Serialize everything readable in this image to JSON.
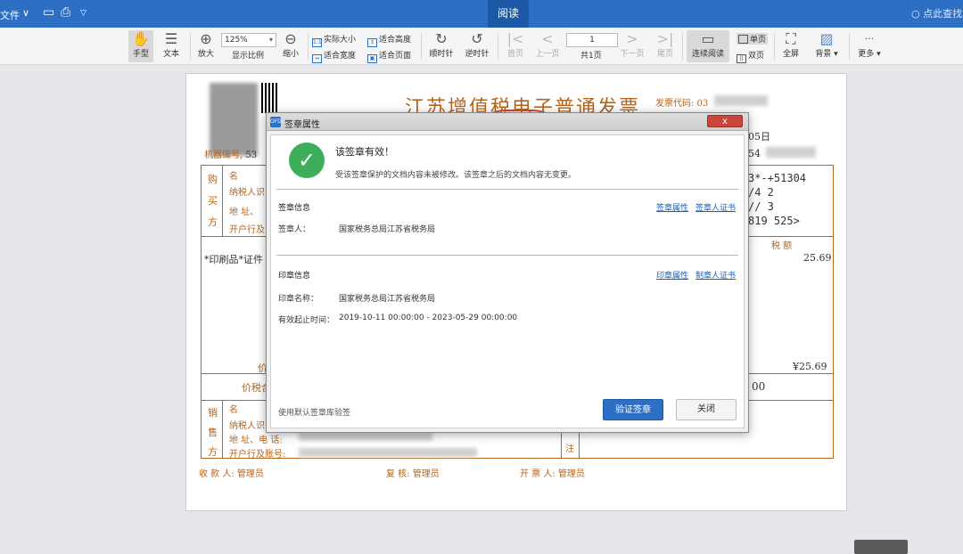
{
  "menubar": {
    "file_label": "文件",
    "active_tab": "阅读",
    "search_placeholder": "点此查找文"
  },
  "toolbar": {
    "hand": "手型",
    "text": "文本",
    "zoom_in": "放大",
    "zoom_value": "125%",
    "zoom_ratio": "显示比例",
    "zoom_out": "缩小",
    "actual_size": "实际大小",
    "fit_width": "适合宽度",
    "fit_height": "适合高度",
    "fit_page": "适合页面",
    "rotate_cw": "顺时针",
    "rotate_ccw": "逆时针",
    "first_page": "首页",
    "prev_page": "上一页",
    "page_value": "1",
    "page_count": "共1页",
    "next_page": "下一页",
    "last_page": "尾页",
    "continuous": "连续阅读",
    "single_page": "单页",
    "double_page": "双页",
    "fullscreen": "全屏",
    "background": "背景",
    "more_dots": "···",
    "more": "更多"
  },
  "invoice": {
    "title": "江苏增值税电子普通发票",
    "code_label": "发票代码: 03",
    "date_fragment": "05日",
    "num_fragment": "54",
    "machine_label": "机器编号",
    "machine_suffix": "53",
    "buyer_1": "购",
    "buyer_2": "买",
    "buyer_3": "方",
    "field_name": "名",
    "field_taxid": "纳税人识",
    "field_addr": "地 址、",
    "field_bank": "开户行及",
    "cipher_1": "3*-+51304",
    "cipher_2": "/4      2",
    "cipher_3": "//      3",
    "cipher_4": "819  525>",
    "tax_header": "税  额",
    "item": "*印刷品*证件",
    "tax_amount": "25.69",
    "subtotal_label": "价",
    "tax_total": "¥25.69",
    "total_label": "价税合",
    "total_value": "00",
    "seller_1": "销",
    "seller_2": "售",
    "seller_3": "方",
    "seller_name": "名",
    "seller_taxid": "纳税人识",
    "seller_addr": "地 址、电 话:",
    "seller_bank": "开户行及账号:",
    "note_label": "注",
    "payee": "收 款 人: 管理员",
    "reviewer": "复  核: 管理员",
    "issuer": "开 票 人: 管理员"
  },
  "dialog": {
    "title": "签章属性",
    "close_label": "x",
    "status": "该签章有效！",
    "status_detail": "受该签章保护的文档内容未被修改。该签章之后的文档内容无变更。",
    "sig_section": "签章信息",
    "sig_props_link": "签章属性",
    "sig_cert_link": "签章人证书",
    "signer_label": "签章人：",
    "signer_value": "国家税务总局江苏省税务局",
    "seal_section": "印章信息",
    "seal_props_link": "印章属性",
    "maker_cert_link": "制章人证书",
    "seal_name_label": "印章名称：",
    "seal_name_value": "国家税务总局江苏省税务局",
    "validity_label": "有效起止时间：",
    "validity_value": "2019-10-11 00:00:00 - 2023-05-29 00:00:00",
    "default_lib": "使用默认签章库验签",
    "verify_button": "验证签章",
    "close_button": "关闭"
  }
}
